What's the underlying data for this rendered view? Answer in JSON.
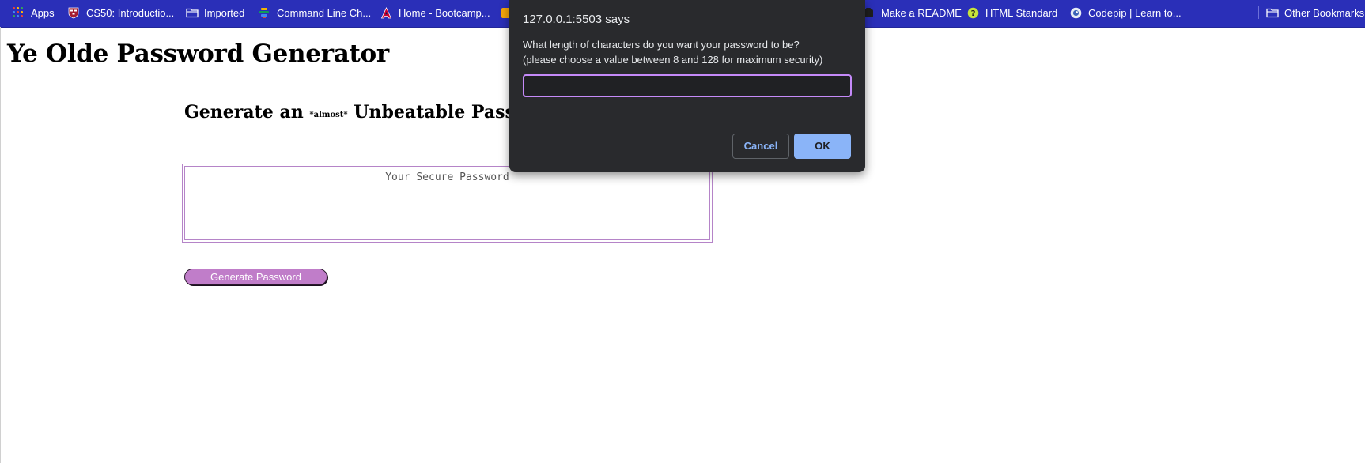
{
  "bookmarks": {
    "apps": "Apps",
    "cs50": "CS50: Introductio...",
    "imported": "Imported",
    "command_line": "Command Line Ch...",
    "home_bootcamp": "Home - Bootcamp...",
    "make_readme": "Make a README",
    "html_standard": "HTML Standard",
    "codepip": "Codepip | Learn to...",
    "other_bookmarks": "Other Bookmarks"
  },
  "page": {
    "title": "Ye Olde Password Generator",
    "subheading_pre": "Generate an ",
    "subheading_small": "*almost*",
    "subheading_post": " Unbeatable Password!",
    "password_placeholder": "Your Secure Password",
    "generate_button": "Generate Password"
  },
  "dialog": {
    "origin": "127.0.0.1:5503 says",
    "message_line1": "What length of characters do you want your password to be?",
    "message_line2": "(please choose a value between 8 and 128 for maximum security)",
    "input_value": "",
    "cancel_label": "Cancel",
    "ok_label": "OK"
  },
  "colors": {
    "bookmarks_bar": "#2a2fb8",
    "dialog_bg": "#292a2d",
    "accent_blue": "#8ab4f8",
    "input_focus": "#c58af9",
    "button_purple": "#c07dc9"
  }
}
